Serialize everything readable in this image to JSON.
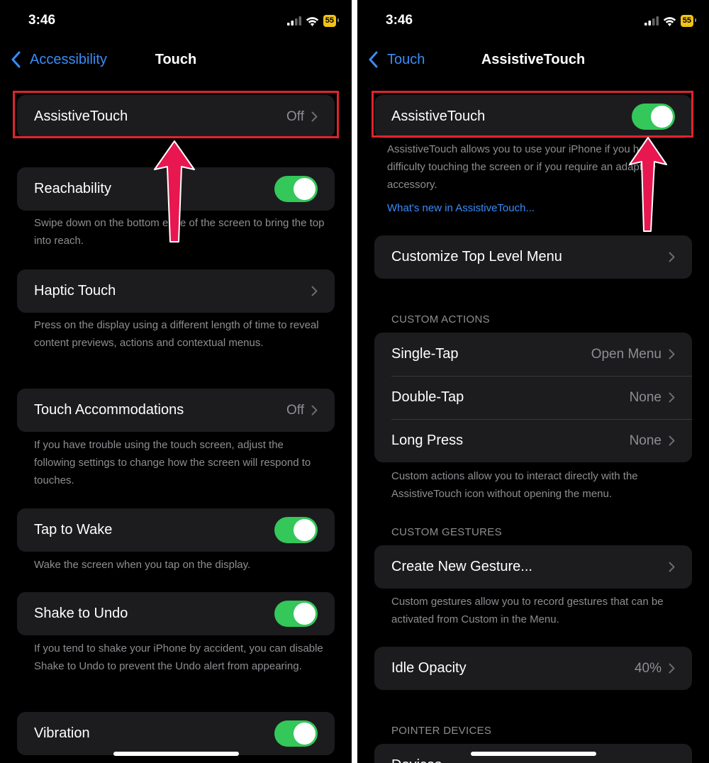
{
  "left": {
    "status": {
      "time": "3:46",
      "battery": "55"
    },
    "nav": {
      "back_label": "Accessibility",
      "title": "Touch"
    },
    "assistive_touch": {
      "label": "AssistiveTouch",
      "value": "Off"
    },
    "reachability": {
      "label": "Reachability",
      "on": true,
      "footer": "Swipe down on the bottom edge of the screen to bring the top into reach."
    },
    "haptic_touch": {
      "label": "Haptic Touch",
      "footer": "Press on the display using a different length of time to reveal content previews, actions and contextual menus."
    },
    "touch_accommodations": {
      "label": "Touch Accommodations",
      "value": "Off",
      "footer": "If you have trouble using the touch screen, adjust the following settings to change how the screen will respond to touches."
    },
    "tap_to_wake": {
      "label": "Tap to Wake",
      "on": true,
      "footer": "Wake the screen when you tap on the display."
    },
    "shake_to_undo": {
      "label": "Shake to Undo",
      "on": true,
      "footer": "If you tend to shake your iPhone by accident, you can disable Shake to Undo to prevent the Undo alert from appearing."
    },
    "vibration": {
      "label": "Vibration",
      "on": true
    }
  },
  "right": {
    "status": {
      "time": "3:46",
      "battery": "55"
    },
    "nav": {
      "back_label": "Touch",
      "title": "AssistiveTouch"
    },
    "assistive_touch": {
      "label": "AssistiveTouch",
      "on": true,
      "footer": "AssistiveTouch allows you to use your iPhone if you have difficulty touching the screen or if you require an adaptive accessory.",
      "link": "What's new in AssistiveTouch..."
    },
    "customize_menu": {
      "label": "Customize Top Level Menu"
    },
    "custom_actions": {
      "header": "CUSTOM ACTIONS",
      "single_tap": {
        "label": "Single-Tap",
        "value": "Open Menu"
      },
      "double_tap": {
        "label": "Double-Tap",
        "value": "None"
      },
      "long_press": {
        "label": "Long Press",
        "value": "None"
      },
      "footer": "Custom actions allow you to interact directly with the AssistiveTouch icon without opening the menu."
    },
    "custom_gestures": {
      "header": "CUSTOM GESTURES",
      "create": {
        "label": "Create New Gesture..."
      },
      "footer": "Custom gestures allow you to record gestures that can be activated from Custom in the Menu."
    },
    "idle_opacity": {
      "label": "Idle Opacity",
      "value": "40%"
    },
    "pointer_devices": {
      "header": "POINTER DEVICES",
      "devices": {
        "label": "Devices"
      }
    }
  },
  "colors": {
    "accent": "#3a8cf7",
    "toggle_on": "#34c759",
    "highlight": "#e0242e",
    "arrow": "#e8174f",
    "cell": "#1c1c1e"
  }
}
